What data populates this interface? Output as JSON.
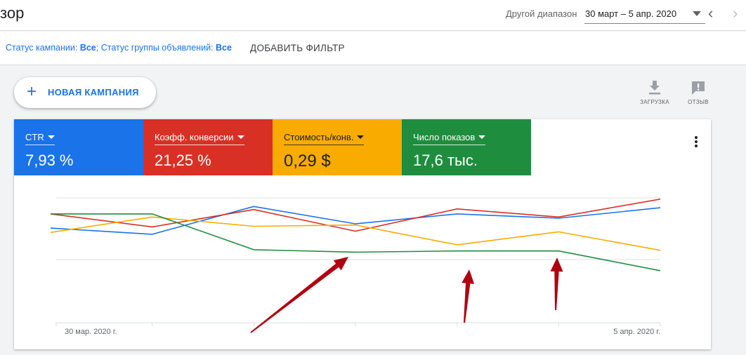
{
  "header": {
    "title": "зор",
    "range_label": "Другой диапазон",
    "range_value": "30 март – 5 апр. 2020",
    "prev_icon": "chevron-left-icon",
    "next_icon": "chevron-right-icon"
  },
  "filter": {
    "campaign_status_label": "Статус кампании: ",
    "campaign_status_value": "Все",
    "separator": "; ",
    "adgroup_status_label": "Статус группы объявлений: ",
    "adgroup_status_value": "Все",
    "add_filter": "ДОБАВИТЬ ФИЛЬТР"
  },
  "actions": {
    "new_campaign": "НОВАЯ КАМПАНИЯ",
    "download": "ЗАГРУЗКА",
    "feedback": "ОТЗЫВ"
  },
  "metrics": [
    {
      "name": "CTR",
      "value": "7,93 %",
      "color": "#1a73e8"
    },
    {
      "name": "Коэфф. конверсии",
      "value": "21,25 %",
      "color": "#d93025"
    },
    {
      "name": "Стоимость/конв.",
      "value": "0,29 $",
      "color": "#f9ab00"
    },
    {
      "name": "Число показов",
      "value": "17,6 тыс.",
      "color": "#1e8e3e"
    }
  ],
  "chart_data": {
    "type": "line",
    "x": [
      "30 мар. 2020 г.",
      "",
      "",
      "",
      "",
      "",
      "5 апр. 2020 г."
    ],
    "x_tick_labels": [
      "30 мар. 2020 г.",
      "5 апр. 2020 г."
    ],
    "ylim": [
      0,
      100
    ],
    "grid": true,
    "series": [
      {
        "name": "CTR",
        "color": "#1a73e8",
        "values": [
          51,
          41,
          86,
          58,
          74,
          67,
          84
        ]
      },
      {
        "name": "Коэфф. конверсии",
        "color": "#d93025",
        "values": [
          74,
          53,
          81,
          46,
          82,
          69,
          98
        ]
      },
      {
        "name": "Стоимость/конв.",
        "color": "#f9ab00",
        "values": [
          44,
          69,
          54,
          56,
          24,
          45,
          15
        ]
      },
      {
        "name": "Число показов",
        "color": "#1e8e3e",
        "values": [
          74,
          74,
          16,
          12,
          14,
          14,
          -18
        ]
      }
    ],
    "annotations_color": "#b00010"
  }
}
